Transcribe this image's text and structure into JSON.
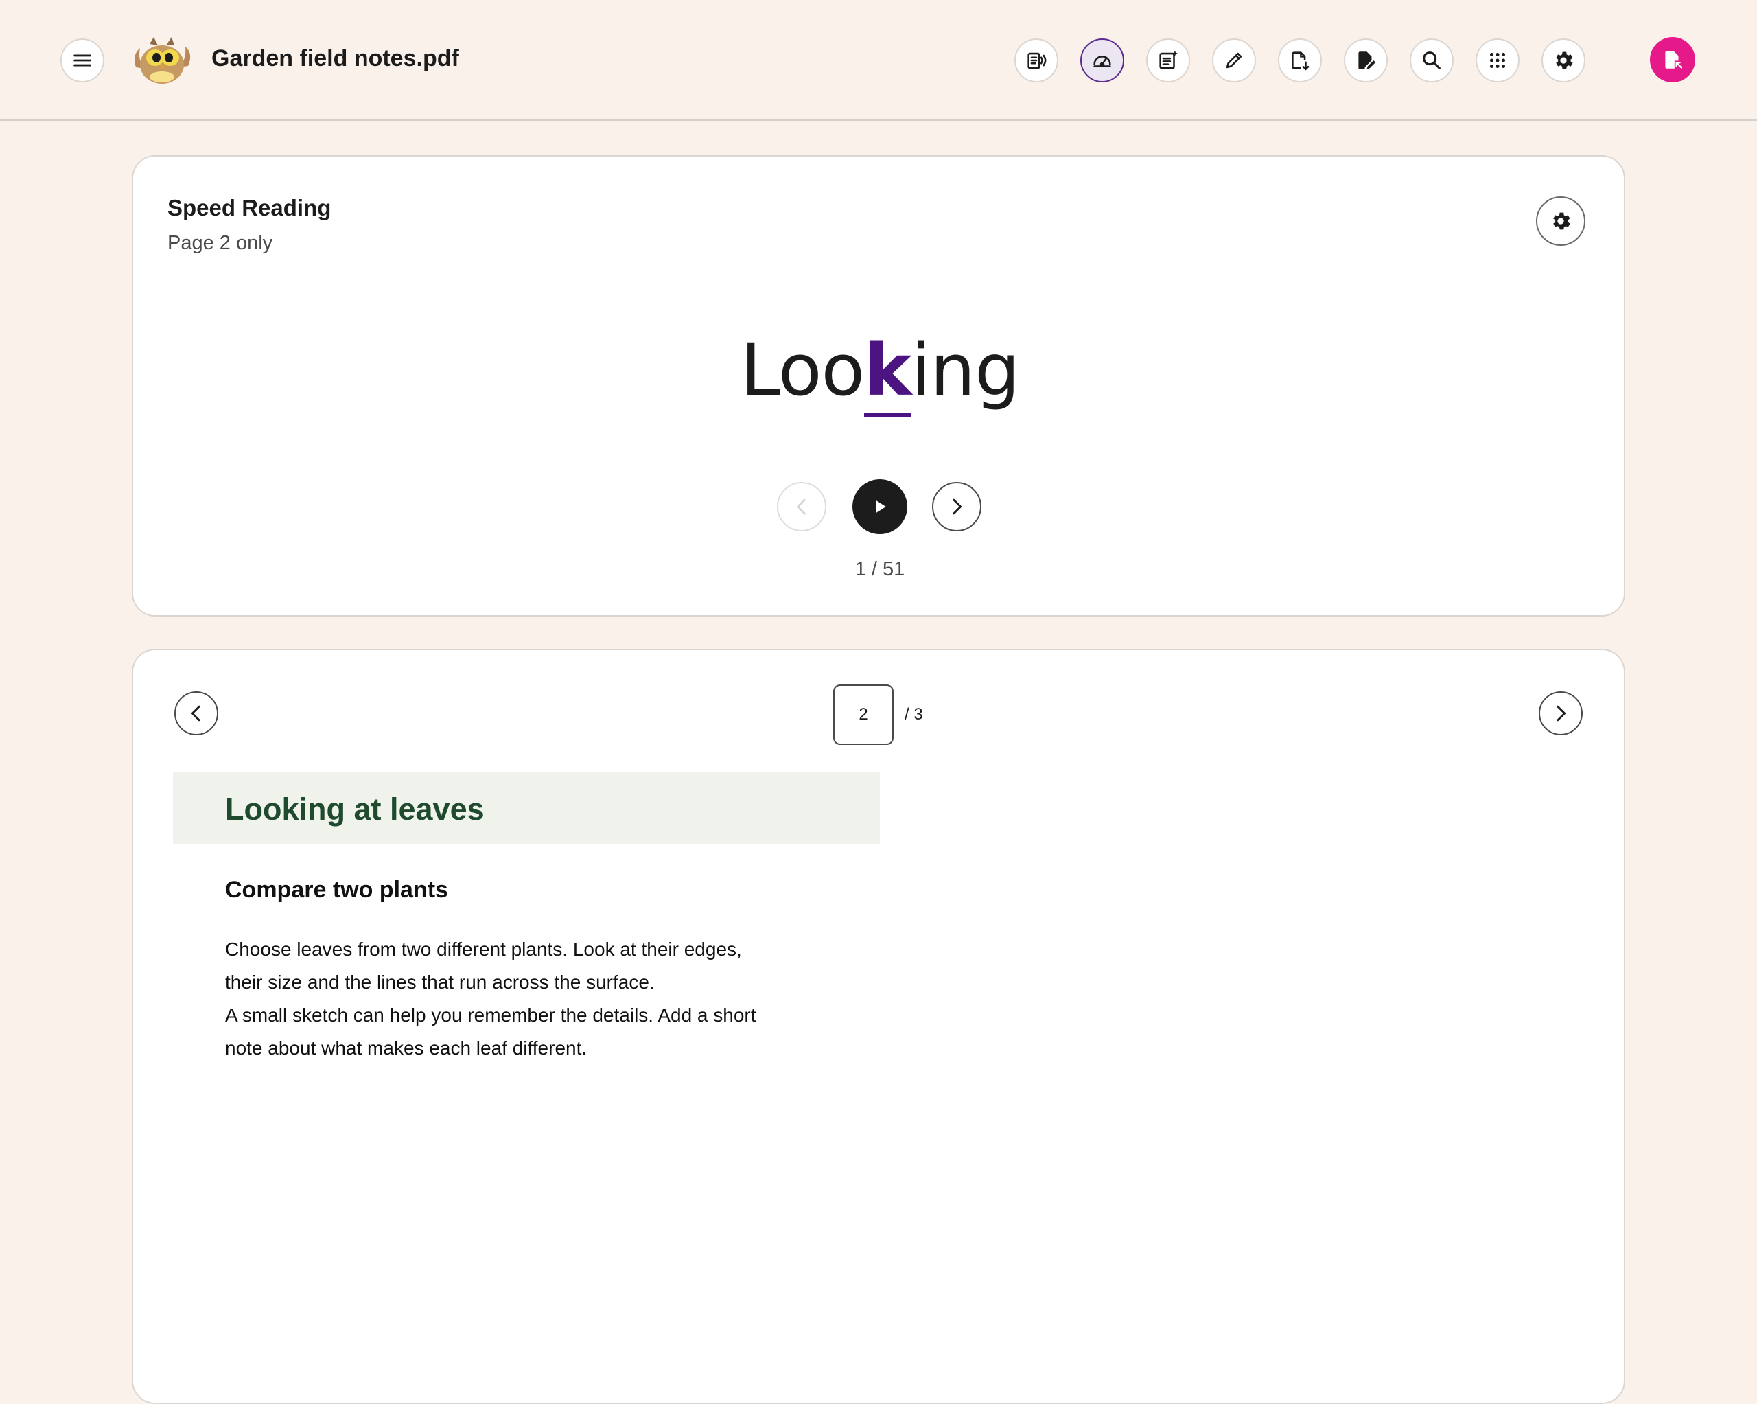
{
  "header": {
    "title": "Garden field notes.pdf",
    "toolbar_icons": [
      "read-aloud-icon",
      "speed-reading-icon",
      "ai-notes-icon",
      "pencil-icon",
      "download-file-icon",
      "edit-file-icon",
      "search-icon",
      "apps-grid-icon",
      "settings-icon"
    ],
    "active_tool": "speed-reading-icon",
    "accent_color": "#5b2d8e",
    "profile_color": "#e6198a"
  },
  "speed_reading": {
    "title": "Speed Reading",
    "subtitle": "Page 2 only",
    "word_before": "Loo",
    "word_pivot": "k",
    "word_after": "ing",
    "counter": "1 / 51",
    "pivot_color": "#4b1480"
  },
  "viewer": {
    "current_page": "2",
    "total_pages": "/ 3",
    "heading": "Looking at leaves",
    "subheading": "Compare two plants",
    "body_lines": [
      "Choose leaves from two different plants. Look at their edges,",
      "their size and the lines that run across the surface.",
      "A small sketch can help you remember the details. Add a short",
      "note about what makes each leaf different."
    ],
    "heading_color": "#1f4a2e",
    "banner_color": "#eff3ec"
  }
}
